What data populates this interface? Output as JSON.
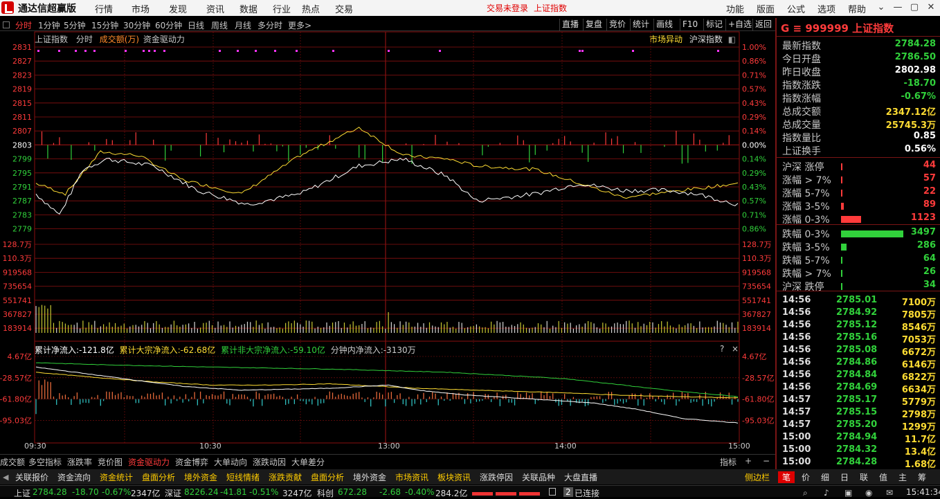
{
  "titlebar": {
    "app_title": "通达信超赢版",
    "menus": [
      "行情",
      "市场",
      "发现",
      "资讯",
      "数据",
      "行业",
      "热点",
      "交易"
    ],
    "status_trade": "交易未登录",
    "status_index": "上证指数",
    "tools": [
      "功能",
      "版面",
      "公式",
      "选项",
      "帮助"
    ]
  },
  "periods": [
    "分时",
    "1分钟",
    "5分钟",
    "15分钟",
    "30分钟",
    "60分钟",
    "日线",
    "周线",
    "月线",
    "多分时",
    "更多>"
  ],
  "toolbar_right": [
    "直播",
    "复盘",
    "竞价",
    "统计",
    "画线",
    "F10",
    "标记",
    "+自选",
    "返回"
  ],
  "chart_header": {
    "name": "上证指数",
    "mode": "分时",
    "vol_label": "成交额(万)",
    "indicator": "资金驱动力"
  },
  "chart_hints": {
    "market_move": "市场异动",
    "market_name": "沪深指数"
  },
  "price_axis": {
    "left": [
      "2831",
      "2827",
      "2823",
      "2819",
      "2815",
      "2811",
      "2807",
      "2803",
      "2799",
      "2795",
      "2791",
      "2787",
      "2783",
      "2779"
    ],
    "right": [
      "1.00%",
      "0.86%",
      "0.71%",
      "0.57%",
      "0.43%",
      "0.29%",
      "0.14%",
      "0.00%",
      "0.14%",
      "0.29%",
      "0.43%",
      "0.57%",
      "0.71%",
      "0.86%"
    ]
  },
  "volume_axis": [
    "128.7万",
    "110.3万",
    "919568",
    "735654",
    "551741",
    "367827",
    "183914"
  ],
  "indicator": {
    "label_total": "累计净流入:-121.8亿",
    "label_block": "累计大宗净流入:-62.68亿",
    "label_nonblock": "累计非大宗净流入:-59.10亿",
    "label_minute": "分钟内净流入:-3130万",
    "axis": [
      "4.67亿",
      "-28.57亿",
      "-61.80亿",
      "-95.03亿"
    ],
    "help": "?",
    "close": "×"
  },
  "time_axis": [
    "09:30",
    "10:30",
    "13:00",
    "14:00",
    "15:00"
  ],
  "quote": {
    "code": "G ≡ 999999 上证指数",
    "rows": [
      {
        "k": "最新指数",
        "v": "2784.28",
        "c": "#31d13b"
      },
      {
        "k": "今日开盘",
        "v": "2786.50",
        "c": "#31d13b"
      },
      {
        "k": "昨日收盘",
        "v": "2802.98",
        "c": "#ffffff"
      },
      {
        "k": "指数涨跌",
        "v": "-18.70",
        "c": "#31d13b"
      },
      {
        "k": "指数涨幅",
        "v": "-0.67%",
        "c": "#31d13b"
      },
      {
        "k": "总成交额",
        "v": "2347.12亿",
        "c": "#ffdd33"
      },
      {
        "k": "总成交量",
        "v": "25745.3万",
        "c": "#ffdd33"
      },
      {
        "k": "指数量比",
        "v": "0.85",
        "c": "#ffffff"
      },
      {
        "k": "上证换手",
        "v": "0.56%",
        "c": "#ffffff"
      }
    ],
    "breadth": [
      {
        "k": "沪深 涨停",
        "v": "44",
        "frac": 0.002,
        "c": "#ff3b3b"
      },
      {
        "k": "涨幅 > 7%",
        "v": "57",
        "frac": 0.003,
        "c": "#ff3b3b"
      },
      {
        "k": "涨幅 5-7%",
        "v": "22",
        "frac": 0.002,
        "c": "#ff3b3b"
      },
      {
        "k": "涨幅 3-5%",
        "v": "89",
        "frac": 0.04,
        "c": "#ff3b3b"
      },
      {
        "k": "涨幅 0-3%",
        "v": "1123",
        "frac": 0.32,
        "c": "#ff3b3b"
      },
      {
        "k": "跌幅 0-3%",
        "v": "3497",
        "frac": 1.0,
        "c": "#31d13b"
      },
      {
        "k": "跌幅 3-5%",
        "v": "286",
        "frac": 0.09,
        "c": "#31d13b"
      },
      {
        "k": "跌幅 5-7%",
        "v": "64",
        "frac": 0.003,
        "c": "#31d13b"
      },
      {
        "k": "跌幅 > 7%",
        "v": "26",
        "frac": 0.002,
        "c": "#31d13b"
      },
      {
        "k": "沪深 跌停",
        "v": "34",
        "frac": 0.002,
        "c": "#31d13b"
      }
    ],
    "ticks": [
      {
        "t": "14:56",
        "p": "2785.01",
        "v": "7100万"
      },
      {
        "t": "14:56",
        "p": "2784.92",
        "v": "7805万"
      },
      {
        "t": "14:56",
        "p": "2785.12",
        "v": "8546万"
      },
      {
        "t": "14:56",
        "p": "2785.16",
        "v": "7053万"
      },
      {
        "t": "14:56",
        "p": "2785.08",
        "v": "6672万"
      },
      {
        "t": "14:56",
        "p": "2784.86",
        "v": "6146万"
      },
      {
        "t": "14:56",
        "p": "2784.84",
        "v": "6822万"
      },
      {
        "t": "14:56",
        "p": "2784.69",
        "v": "6634万"
      },
      {
        "t": "14:57",
        "p": "2785.17",
        "v": "5779万"
      },
      {
        "t": "14:57",
        "p": "2785.15",
        "v": "2798万"
      },
      {
        "t": "14:57",
        "p": "2785.20",
        "v": "1299万"
      },
      {
        "t": "15:00",
        "p": "2784.94",
        "v": "11.7亿"
      },
      {
        "t": "15:00",
        "p": "2784.32",
        "v": "13.4亿"
      },
      {
        "t": "15:00",
        "p": "2784.28",
        "v": "1.68亿"
      }
    ]
  },
  "tabs1": [
    "成交额",
    "多空指标",
    "涨跌率",
    "竞价图",
    "资金驱动力",
    "资金博弈",
    "大单动向",
    "涨跌动因",
    "大单差分"
  ],
  "tabs1_active": "资金驱动力",
  "tabs1_right": {
    "label": "指标",
    "plus": "+",
    "minus": "−"
  },
  "tabs2": [
    "关联报价",
    "资金流向",
    "资金统计",
    "盘面分析",
    "境外资金",
    "短线情绪",
    "涨跌贡献",
    "盘面分析",
    "境外资金",
    "市场资讯",
    "板块资讯",
    "涨跌停因",
    "关联品种",
    "大盘直播"
  ],
  "tabs2_hl": [
    2,
    3,
    4,
    5,
    6,
    7,
    9,
    10
  ],
  "tabs2_side": "侧边栏",
  "tabs_rt": [
    "笔",
    "价",
    "细",
    "日",
    "联",
    "值",
    "主",
    "筹"
  ],
  "statusbar": {
    "sh_name": "上证",
    "sh_val": "2784.28",
    "sh_chg": "-18.70",
    "sh_pct": "-0.67%",
    "sh_amt": "2347亿",
    "sz_name": "深证",
    "sz_val": "8226.24",
    "sz_chg": "-41.81",
    "sz_pct": "-0.51%",
    "sz_amt": "3247亿",
    "kc_name": "科创",
    "kc_val": "672.28",
    "kc_chg": "-2.68",
    "kc_pct": "-0.40%",
    "kc_amt": "284.2亿",
    "conn_num": "2",
    "conn": "已连接",
    "time": "15:41:34"
  },
  "colors": {
    "grid": "#8a1010",
    "up": "#ff3b3b",
    "down": "#31d13b",
    "price": "#ffffff",
    "avg": "#ffdd33",
    "accent": "#ff3b3b"
  }
}
